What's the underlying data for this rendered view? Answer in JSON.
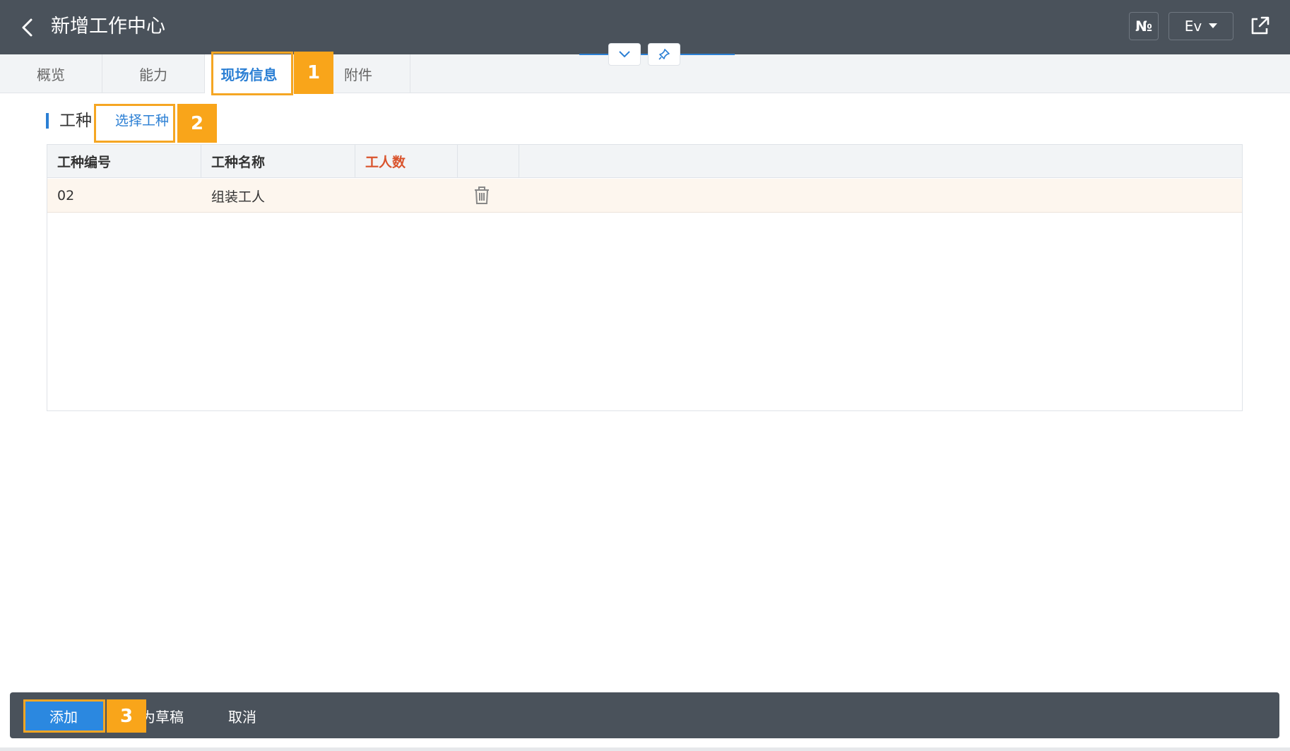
{
  "header": {
    "title": "新增工作中心",
    "numero_label": "№",
    "language": "Ev"
  },
  "tabs": [
    {
      "label": "概览"
    },
    {
      "label": "能力"
    },
    {
      "label": "现场信息",
      "active": true
    },
    {
      "label": "附件"
    }
  ],
  "section": {
    "title": "工种",
    "select_link": "选择工种"
  },
  "table": {
    "columns": [
      "工种编号",
      "工种名称",
      "工人数",
      ""
    ],
    "rows": [
      {
        "code": "02",
        "name": "组装工人",
        "count": ""
      }
    ]
  },
  "callouts": [
    "1",
    "2",
    "3"
  ],
  "footer": {
    "add_label": "添加",
    "draft_label": "为草稿",
    "cancel_label": "取消"
  },
  "colors": {
    "header_bg": "#4a525b",
    "accent": "#2b7fd4",
    "callout": "#f9a51a",
    "required_column": "#d9532c"
  },
  "icons": [
    "back-arrow-icon",
    "share-icon",
    "chevron-down-icon",
    "pin-icon",
    "trash-icon"
  ]
}
